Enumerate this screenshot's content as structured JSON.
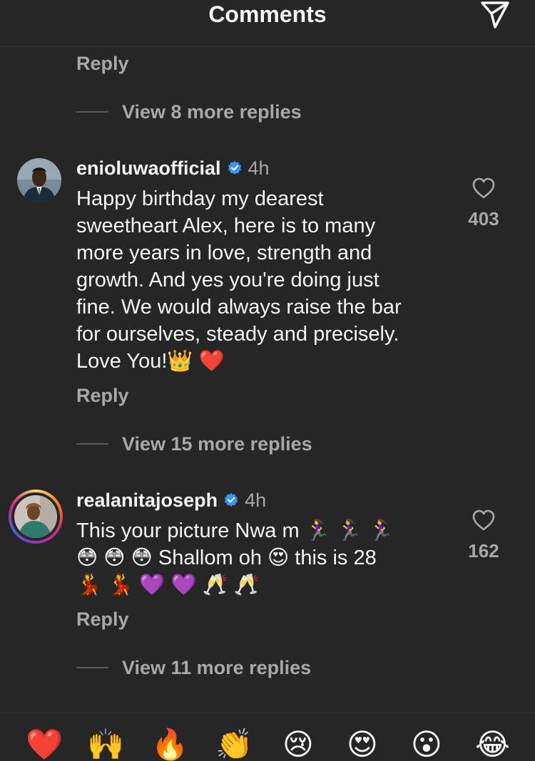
{
  "header": {
    "title": "Comments",
    "send_icon": "paper-plane-icon"
  },
  "top": {
    "reply_label": "Reply",
    "view_replies": "View 8 more replies"
  },
  "comments": [
    {
      "username": "enioluwaofficial",
      "verified": true,
      "time": "4h",
      "text": "Happy birthday my dearest\nsweetheart Alex, here is to many\nmore years in love, strength and\ngrowth. And yes you're doing just\nfine. We would always raise the bar\nfor ourselves, steady and precisely.\nLove You!👑 ❤️",
      "likes": "403",
      "reply_label": "Reply",
      "view_replies": "View 15 more replies"
    },
    {
      "username": "realanitajoseph",
      "verified": true,
      "time": "4h",
      "text": "This your picture Nwa m 🏃‍♀️ 🏃‍♀️ 🏃‍♀️\n😳 😳 😳 Shallom oh 😍 this is 28\n💃 💃 💜 💜 🥂 🥂",
      "likes": "162",
      "reply_label": "Reply",
      "view_replies": "View 11 more replies"
    }
  ],
  "emoji_bar": [
    "❤️",
    "🙌",
    "🔥",
    "👏",
    "😢",
    "😍",
    "😮",
    "😂"
  ],
  "colors": {
    "background": "#262626",
    "text": "#f5f5f5",
    "secondary": "#a8a8a8",
    "verified": "#3897f0"
  }
}
